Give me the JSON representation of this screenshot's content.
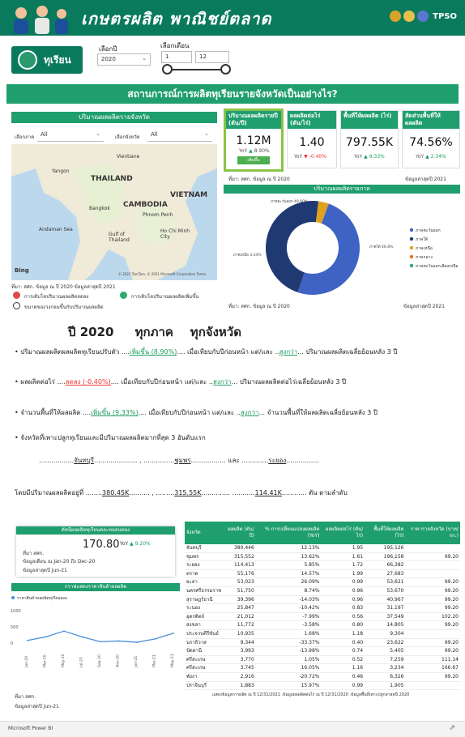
{
  "banner": {
    "title": "เกษตรผลิต พาณิชย์ตลาด",
    "logo_text": "TPSO"
  },
  "product": {
    "name": "ทุเรียน"
  },
  "filters": {
    "year_label": "เลือกปี",
    "year_value": "2020",
    "month_label": "เลือกเดือน",
    "month_from": "1",
    "month_to": "12"
  },
  "section_title": "สถานการณ์การผลิตทุเรียนรายจังหวัดเป็นอย่างไร?",
  "map_panel": {
    "title": "ปริมาณผลผลิตรายจังหวัด",
    "region_label": "เลือกภาค",
    "region_value": "All",
    "province_label": "เลือกจังหวัด",
    "province_value": "All",
    "labels": {
      "thailand": "THAILAND",
      "cambodia": "CAMBODIA",
      "vietnam": "VIETNAM",
      "laos": "Vientiane",
      "yangon": "Yangon",
      "bangkok": "Bangkok",
      "phnom_penh": "Phnom Penh",
      "gulf": "Gulf of Thailand",
      "andaman": "Andaman Sea",
      "hcm": "Ho Chi Minh City"
    },
    "bing": "Bing",
    "copyright": "© 2021 TomTom, © 2021 Microsoft Corporation Terms",
    "source": "ที่มา: สศก. ข้อมูล ณ ปี 2020 ข้อมูลล่าสุดปี 2021",
    "legend": [
      {
        "label": "การเติบโตปริมาณผลผลิตลดลง",
        "color": "#e04a4a"
      },
      {
        "label": "การเติบโตปริมาณผลผลิตเพิ่มขึ้น",
        "color": "#2eaa6e"
      },
      {
        "label": "ขนาดของวงกลมขึ้นกับปริมาณผลผลิต",
        "color": "#ffffff"
      }
    ]
  },
  "kpis": [
    {
      "title": "ปริมาณผลผลิตรายปี (ตัน/ปี)",
      "value": "1.12M",
      "yoy": "YoY",
      "trend": "▲",
      "change": "8.90%",
      "badge": "เพิ่มขึ้น",
      "dir": "up"
    },
    {
      "title": "ผลผลิตต่อไร่ (ตัน/ไร่)",
      "value": "1.40",
      "yoy": "YoY",
      "trend": "▼",
      "change": "-0.40%",
      "dir": "down"
    },
    {
      "title": "พื้นที่ให้ผลผลิต (ไร่)",
      "value": "797.55K",
      "yoy": "YoY",
      "trend": "▲",
      "change": "9.33%",
      "dir": "up"
    },
    {
      "title": "สัดส่วนพื้นที่ให้ผลผลิต",
      "value": "74.56%",
      "yoy": "YoY",
      "trend": "▲",
      "change": "2.34%",
      "dir": "up"
    }
  ],
  "kpi_source": "ที่มา: สศก. ข้อมูล ณ ปี 2020",
  "kpi_latest": "ข้อมูลล่าสุดปี 2021",
  "donut_title": "ปริมาณผลผลิตรายภาค",
  "donut_source": "ที่มา: สศก. ข้อมูล ณ ปี 2020",
  "donut_latest": "ข้อมูลล่าสุดปี 2021",
  "chart_data": [
    {
      "type": "pie",
      "title": "ปริมาณผลผลิตรายภาค",
      "categories": [
        "ภาคตะวันออก",
        "ภาคใต้",
        "ภาคเหนือ",
        "ภาคกลาง",
        "ภาคตะวันออกเฉียงเหนือ"
      ],
      "values": [
        49.6,
        46.8,
        3.3,
        0.2,
        0.1
      ],
      "colors": [
        "#3e63c3",
        "#1f3a73",
        "#e0a21a",
        "#f26c1d",
        "#2eaa6e"
      ],
      "data_labels": [
        "ภาคตะวันออก 49.60%",
        "ภาคใต้ 46.8%",
        "ภาคเหนือ 3.34%"
      ],
      "legend_position": "right"
    },
    {
      "type": "line",
      "title": "กราฟแสดงราคาสินค้าผลผลิต",
      "legend": "ราคาสินค้าผลผลิตทุเรียนคละ",
      "categories": [
        "Jan-20",
        "Mar-20",
        "May-20",
        "Jul-20",
        "Sep-20",
        "Nov-20",
        "Jan-21",
        "Mar-21",
        "May-21"
      ],
      "series": [
        {
          "name": "ราคาสินค้าผลผลิตทุเรียนคละ",
          "values": [
            50,
            120,
            230,
            120,
            25,
            40,
            15,
            80,
            190
          ]
        }
      ],
      "y_ticks": [
        "1000",
        "500",
        "0"
      ],
      "ylim": [
        0,
        1000
      ]
    }
  ],
  "summary": {
    "heading": "ปี 2020     ทุกภาค    ทุกจังหวัด",
    "line1": {
      "pre": "ปริมาณผลผลิตผลผลิตทุเรียนปรับตัว",
      "v1": "เพิ่มขึ้น  (8.90%)",
      "mid": "เมื่อเทียบกับปีก่อนหน้า แต่/และ",
      "v2": "สูงกว่า",
      "post": "ปริมาณผลผลิตเฉลี่ยย้อนหลัง 3 ปี"
    },
    "line2": {
      "pre": "ผลผลิตต่อไร่",
      "v1": "ลดลง  (-0.40%)",
      "mid": "เมื่อเทียบกับปีก่อนหน้า แต่/และ",
      "v2": "สูงกว่า",
      "post": "ปริมาณผลผลิตต่อไร่เฉลี่ยย้อนหลัง 3 ปี"
    },
    "line3": {
      "pre": "จำนวนพื้นที่ให้ผลผลิต",
      "v1": "เพิ่มขึ้น  (9.33%)",
      "mid": "เมื่อเทียบกับปีก่อนหน้า แต่/และ",
      "v2": "สูงกว่า",
      "post": "จำนวนพื้นที่ให้ผลผลิตเฉลี่ยย้อนหลัง 3 ปี"
    },
    "line4": "จังหวัดที่เพาะปลูกทุเรียนและมีปริมาณผลผลิตมากที่สุด 3 อันดับแรก",
    "top1": "จันทบุรี",
    "top2": "ชุมพร",
    "top3": "ระยอง",
    "and": "และ",
    "qty_pre": "โดยมีปริมาณผลผลิตอยู่ที่",
    "q1": "380.45K",
    "q2": "315.55K",
    "q3": "114.41K",
    "qty_post": "ตัน ตามลำดับ"
  },
  "price_index": {
    "title": "ดัชนีผลผลิตทุเรียนคละหมอนทอง",
    "value": "170.80",
    "yoy": "YoY",
    "trend": "▲",
    "change": "9.20%",
    "source": "ที่มา สศก.",
    "period_label": "ข้อมูลเดือน ณ",
    "period_from": "Jan-20",
    "period_to_label": "ถึง",
    "period_to": "Dec-20",
    "latest_label": "ข้อมูลล่าสุดปี",
    "latest": "Jun-21"
  },
  "price_chart": {
    "title": "กราฟแสดงราคาสินค้าผลผลิต",
    "legend": "ราคาสินค้าผลผลิตทุเรียนคละ"
  },
  "price_source": {
    "src": "ที่มา สศก.",
    "latest_label": "ข้อมูลล่าสุดปี",
    "latest": "Jun-21"
  },
  "table": {
    "headers": [
      "จังหวัด",
      "ผลผลิต (ตัน/ปี)",
      "% การเปลี่ยนแปลงผลผลิต (YoY)",
      "ผลผลิตต่อไร่ (ตัน/ไร่)",
      "พื้นที่ให้ผลผลิต (ไร่)",
      "ราคารายจังหวัด (บาท/กก.)"
    ],
    "rows": [
      [
        "จันทบุรี",
        "380,446",
        "12.13%",
        "1.95",
        "195,126",
        ""
      ],
      [
        "ชุมพร",
        "315,552",
        "13.62%",
        "1.61",
        "196,158",
        "99.20"
      ],
      [
        "ระยอง",
        "114,413",
        "5.85%",
        "1.72",
        "66,382",
        ""
      ],
      [
        "ตราด",
        "55,176",
        "14.57%",
        "1.99",
        "27,683",
        ""
      ],
      [
        "ยะลา",
        "53,023",
        "26.09%",
        "0.99",
        "53,621",
        "99.20"
      ],
      [
        "นครศรีธรรมราช",
        "51,750",
        "8.74%",
        "0.96",
        "53,670",
        "99.20"
      ],
      [
        "สุราษฎร์ธานี",
        "39,396",
        "-14.03%",
        "0.96",
        "40,967",
        "99.20"
      ],
      [
        "ระนอง",
        "25,847",
        "-10.42%",
        "0.83",
        "31,197",
        "99.20"
      ],
      [
        "อุตรดิตถ์",
        "21,012",
        "-7.99%",
        "0.56",
        "37,549",
        "102.20"
      ],
      [
        "สงขลา",
        "11,772",
        "-3.58%",
        "0.80",
        "14,805",
        "99.20"
      ],
      [
        "ประจวบคีรีขันธ์",
        "10,935",
        "1.68%",
        "1.18",
        "9,304",
        ""
      ],
      [
        "นราธิวาส",
        "9,344",
        "-33.37%",
        "0.40",
        "23,622",
        "99.20"
      ],
      [
        "ปัตตานี",
        "3,993",
        "-13.98%",
        "0.74",
        "5,405",
        "99.20"
      ],
      [
        "ศรีสะเกษ",
        "3,770",
        "1.05%",
        "0.52",
        "7,259",
        "111.14"
      ],
      [
        "ศรีสะเกษ",
        "3,745",
        "16.05%",
        "1.16",
        "3,234",
        "166.67"
      ],
      [
        "พังงา",
        "2,916",
        "-20.72%",
        "0.46",
        "6,326",
        "99.20"
      ],
      [
        "ปราจีนบุรี",
        "1,883",
        "15.97%",
        "0.99",
        "1,905",
        ""
      ]
    ],
    "footnote": "แสดงข้อมูลการผลิต ณ ปี 12/31/2021 ,ข้อมูลผลผลิตต่อไร่ ณ ปี 12/31/2020 ,ข้อมูลพื้นที่เพาะปลูกล่าสุดปี 2020"
  },
  "footer": {
    "label": "Microsoft Power BI"
  }
}
